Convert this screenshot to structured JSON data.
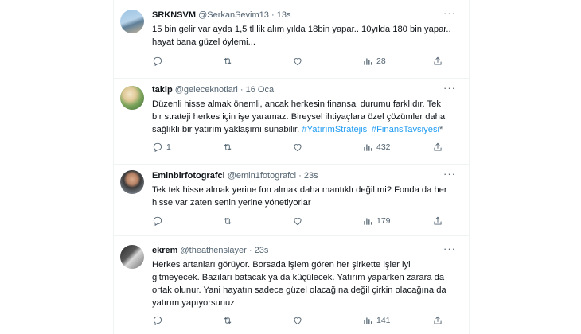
{
  "tweets": [
    {
      "name": "SRKNSVM",
      "handle": "@SerkanSevim13",
      "sep": "·",
      "time": "13s",
      "lines": [
        "15 bin gelir var ayda 1,5 tl lik alım yılda 18bin yapar.. 10yılda 180 bin yapar..",
        "hayat bana güzel öylemi..."
      ],
      "replies": "",
      "retweets": "",
      "likes": "",
      "views": "28"
    },
    {
      "name": "takip",
      "handle": "@gelecek​notlari",
      "sep": "·",
      "time": "16 Oca",
      "lines": [
        "Düzenli hisse almak önemli, ancak herkesin finansal durumu farklıdır. Tek",
        "bir strateji herkes için işe yaramaz. Bireysel ihtiyaçlara özel çözümler daha"
      ],
      "line3_text": "sağlıklı bir yatırım yaklaşımı sunabilir.",
      "hashtag1": "#YatırımStratejisi",
      "hashtag2": "#FinansTavsiyesi",
      "suffix": "*",
      "replies": "1",
      "retweets": "",
      "likes": "",
      "views": "432"
    },
    {
      "name": "Eminbirfotografci",
      "handle": "@emin1fotografci",
      "sep": "·",
      "time": "23s",
      "lines": [
        "Tek tek hisse almak yerine fon almak daha mantıklı değil mi? Fonda da her",
        "hisse var zaten senin yerine yönetiyorlar"
      ],
      "replies": "",
      "retweets": "",
      "likes": "",
      "views": "179"
    },
    {
      "name": "ekrem",
      "handle": "@theathenslayer",
      "sep": "·",
      "time": "23s",
      "lines": [
        "Herkes artanları görüyor. Borsada işlem gören her şirkette işler iyi",
        "gitmeyecek. Bazıları batacak ya da küçülecek. Yatırım yaparken zarara da",
        "ortak olunur. Yani hayatın sadece güzel olacağına değil çirkin olacağına da",
        "yatırım yapıyorsunuz."
      ],
      "replies": "",
      "retweets": "",
      "likes": "",
      "views": "141"
    }
  ],
  "icons": {
    "more": "more-icon",
    "reply": "reply-icon",
    "retweet": "retweet-icon",
    "like": "heart-icon",
    "views": "views-icon",
    "share": "share-icon"
  },
  "colors": {
    "text": "#0f1419",
    "muted": "#536471",
    "link": "#1d9bf0",
    "border": "#eff3f4"
  }
}
